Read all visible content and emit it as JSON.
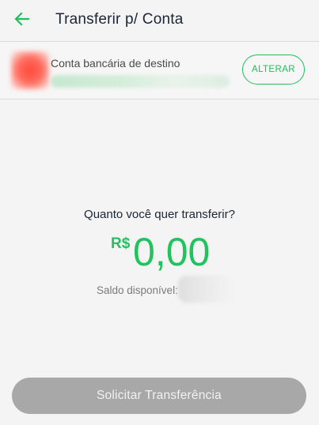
{
  "header": {
    "back_icon": "arrow-left-icon",
    "title": "Transferir p/ Conta",
    "accent_color": "#1fbf5a"
  },
  "destination": {
    "label": "Conta bancária de destino",
    "bank_logo": "bank-logo (obscured)",
    "change_label": "ALTERAR"
  },
  "transfer": {
    "question": "Quanto você quer transferir?",
    "currency": "R$",
    "amount": "0,00",
    "balance_label": "Saldo disponível:"
  },
  "actions": {
    "submit_label": "Solicitar Transferência",
    "submit_disabled_color": "#a8a8a8"
  }
}
